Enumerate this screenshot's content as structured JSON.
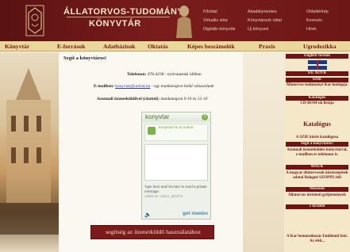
{
  "header": {
    "title_line1": "ÁLLATORVOS-TUDOMÁNYI",
    "title_line2": "KÖNYVTÁR",
    "links_col1": [
      "Főoldal",
      "Virtuális séta",
      "Digitális könyvtár"
    ],
    "links_col2": [
      "Akadálymentes",
      "Könyvtárunk oldal",
      "Új könyvek"
    ],
    "links_col3": [
      "Oldaltérkép",
      "Keresés",
      "Hírek"
    ]
  },
  "nav": {
    "items": [
      "Könyvtár",
      "E-források",
      "Adatbázisok",
      "Oktatás",
      "Képes beszámolók",
      "Praxis",
      "Ugrodezikka"
    ]
  },
  "content": {
    "heading": "Segít a könyvtáros!",
    "phone_label": "Telefonon:",
    "phone_value": "478-4238 - nyitvatartási időben",
    "email_label": "E-mailben:",
    "email_value": "konyvtar@univet.hu",
    "email_note": "- egy munkanapon belül válaszolunk",
    "instant_label": "Azonnali üzenetküldővel (chattel):",
    "instant_value": "munkanapon 9-10 és 12-10"
  },
  "widget": {
    "title": "konyvtar",
    "help_icon": "?",
    "status_text": "konyvtar.hu is online.",
    "hint_text": "Type here and hit enter to send a private message.",
    "name_label": "called as:",
    "name_value": "visitor_d0c879",
    "logo": "get meebo"
  },
  "footer": {
    "button_label": "segítség az üzenetküldő használatához"
  },
  "sidebar": {
    "english_label": "English version",
    "sote_label": "S/E ÁOTK",
    "szie_label": "SZIE",
    "szie_sub": "Állatorvos-tudományi Kar honlapja.",
    "katalogus_label": "Katalógus",
    "katalogus_sub": "CD-ROM-ok listája",
    "katalogus_title": "Katalógus",
    "online_title": "A SZIE közös katalógusa",
    "help_title": "Segít a könyvtáros!",
    "help_sub": "Azonnali üzenetküldés könyvtárral, e-mailben és telefonon is.",
    "mauk_title": "MAUK",
    "mauk_sub": "A magyar állatorvosok közösségének adatai Balogné SZOPPE-ből",
    "muzeum_title": "Múzeum",
    "muzeum_sub": "Állatorvos történeti gyűjtemények",
    "more_title": "1 további",
    "bottom_sub": "A Kar bemutatkozás Emlékmű fotó. Az első..."
  }
}
